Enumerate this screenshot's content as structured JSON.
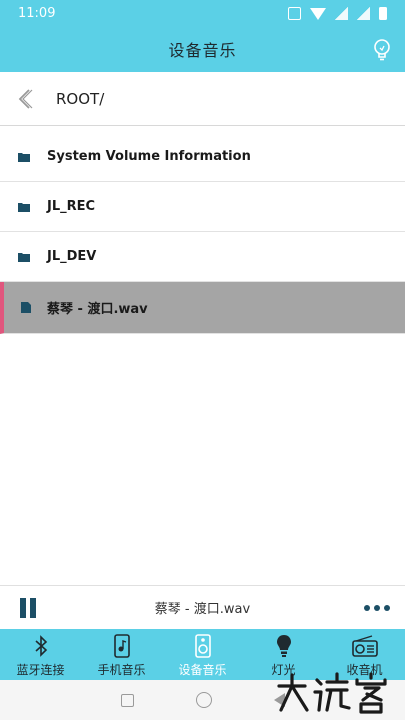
{
  "status_bar": {
    "time": "11:09"
  },
  "header": {
    "title": "设备音乐"
  },
  "path_bar": {
    "path": "ROOT/"
  },
  "files": [
    {
      "name": "System Volume Information",
      "type": "folder",
      "selected": false
    },
    {
      "name": "JL_REC",
      "type": "folder",
      "selected": false
    },
    {
      "name": "JL_DEV",
      "type": "folder",
      "selected": false
    },
    {
      "name": "蔡琴 - 渡口.wav",
      "type": "file",
      "selected": true
    }
  ],
  "player": {
    "now_playing": "蔡琴 - 渡口.wav",
    "state": "playing"
  },
  "tabs": [
    {
      "label": "蓝牙连接",
      "icon": "bluetooth-icon",
      "active": false
    },
    {
      "label": "手机音乐",
      "icon": "phone-music-icon",
      "active": false
    },
    {
      "label": "设备音乐",
      "icon": "speaker-icon",
      "active": true
    },
    {
      "label": "灯光",
      "icon": "lightbulb-icon",
      "active": false
    },
    {
      "label": "收音机",
      "icon": "radio-icon",
      "active": false
    }
  ],
  "colors": {
    "primary": "#5bd0e6",
    "selected_row": "#a5a5a5",
    "selected_accent": "#e0567d",
    "icon_dark": "#1c4f66"
  }
}
